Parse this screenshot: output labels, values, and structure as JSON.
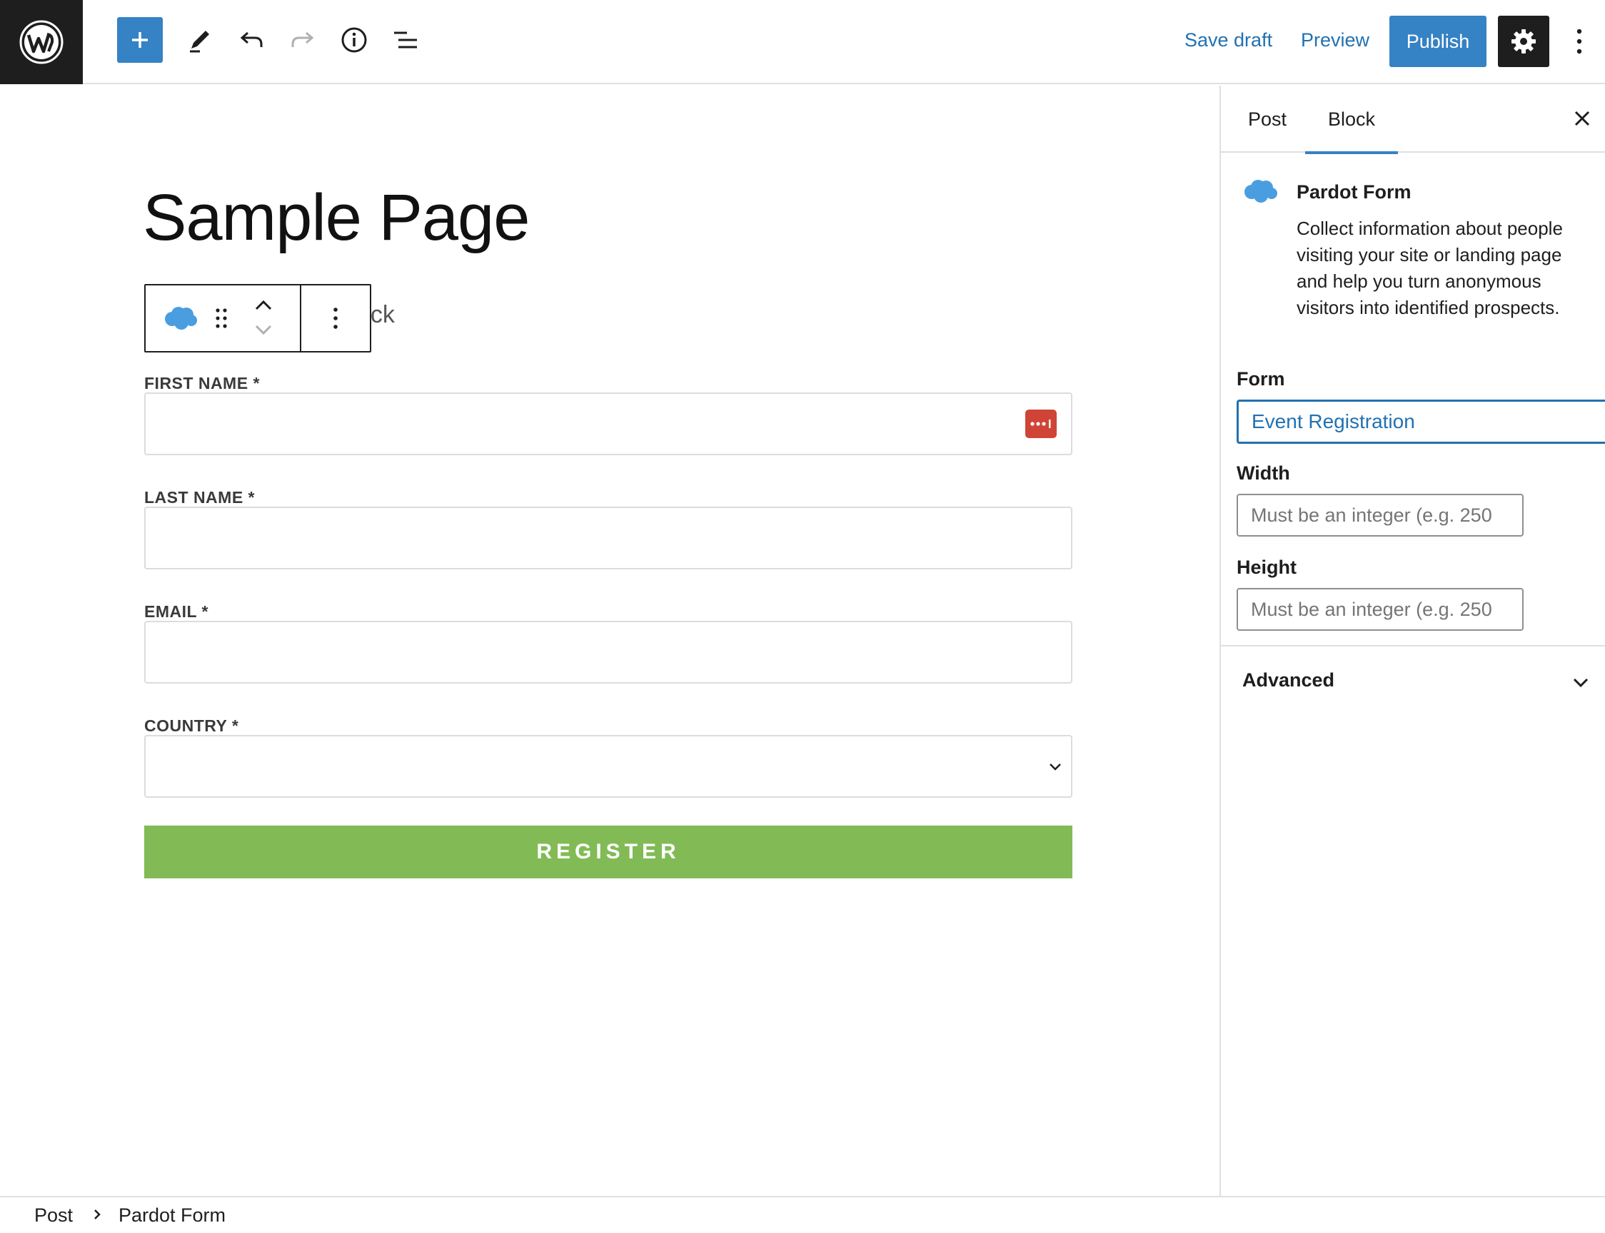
{
  "toolbar": {
    "save_draft": "Save draft",
    "preview": "Preview",
    "publish": "Publish"
  },
  "editor": {
    "page_title": "Sample Page",
    "obscured_text": "ock",
    "form": {
      "fields": [
        {
          "label": "FIRST NAME *",
          "type": "text"
        },
        {
          "label": "LAST NAME *",
          "type": "text"
        },
        {
          "label": "EMAIL *",
          "type": "text"
        },
        {
          "label": "COUNTRY *",
          "type": "select"
        }
      ],
      "submit_label": "REGISTER"
    }
  },
  "sidebar": {
    "tabs": [
      "Post",
      "Block"
    ],
    "active_tab": "Block",
    "block_card": {
      "title": "Pardot Form",
      "description": "Collect information about people visiting your site or landing page and help you turn anonymous visitors into identified prospects."
    },
    "form_label": "Form",
    "form_value": "Event Registration",
    "width_label": "Width",
    "width_placeholder": "Must be an integer (e.g. 250",
    "height_label": "Height",
    "height_placeholder": "Must be an integer (e.g. 250",
    "advanced_label": "Advanced"
  },
  "breadcrumb": [
    "Post",
    "Pardot Form"
  ],
  "colors": {
    "accent": "#3582c4",
    "link": "#2271b1",
    "register": "#82bb55",
    "password_badge": "#d04437",
    "salesforce": "#4a9ee0"
  }
}
